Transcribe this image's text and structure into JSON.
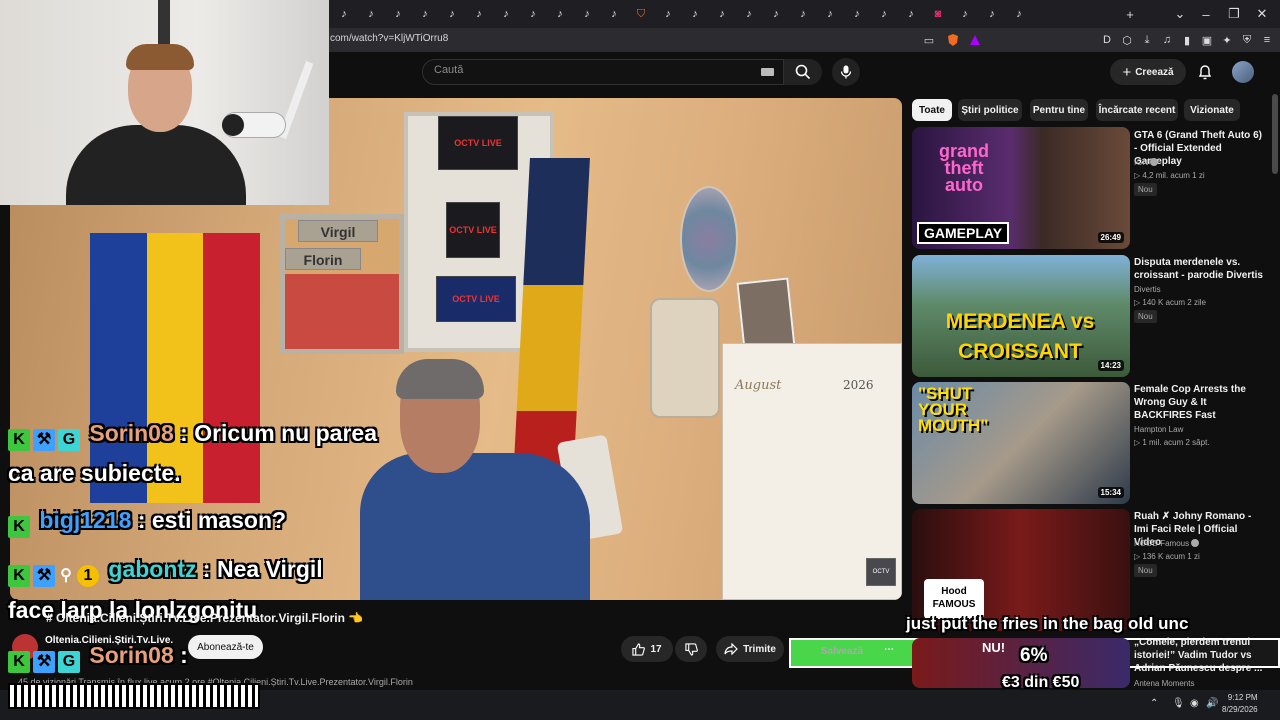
{
  "browser": {
    "url": "com/watch?v=KljWTiOrru8",
    "tab_icons": [
      "tiktok-icon",
      "tiktok-icon",
      "tiktok-icon",
      "tiktok-icon",
      "tiktok-icon",
      "tiktok-icon",
      "tiktok-icon",
      "tiktok-icon",
      "tiktok-icon",
      "tiktok-icon",
      "tiktok-icon",
      "brave-icon",
      "tiktok-icon",
      "tiktok-icon",
      "tiktok-icon",
      "tiktok-icon",
      "tiktok-icon",
      "tiktok-icon",
      "tiktok-icon",
      "tiktok-icon",
      "tiktok-icon",
      "tiktok-icon",
      "instagram-icon",
      "tiktok-icon",
      "tiktok-icon",
      "tiktok-icon"
    ]
  },
  "header": {
    "search_placeholder": "Caută",
    "create_label": "Creează"
  },
  "chat": [
    {
      "user": "Sorin08",
      "message": " : Oricum nu parea",
      "user_color": "#e8a07a"
    },
    {
      "continuation": "ca are subiecte."
    },
    {
      "user": "bigj1218",
      "message": " : esti mason?",
      "user_color": "#3ea0ff"
    },
    {
      "user": "gabontz",
      "message": " : Nea Virgil",
      "user_color": "#3fd4d4",
      "coin": "1"
    },
    {
      "continuation": "face larp la lonlzgonitu"
    },
    {
      "user": "Sorin08",
      "message": " :",
      "user_color": "#e8a07a"
    }
  ],
  "video": {
    "title": "# Oltenia.Cilieni.Știri.Tv.Live.Prezentator.Virgil.Florin 👈",
    "channel": "Oltenia.Cilieni.Știri.Tv.Live.",
    "subscribe_label": "Abonează-te",
    "likes": "17",
    "share_label": "Trimite",
    "save_label": "Salvează",
    "description": "45 de vizionări  Transmis în flux live acum 2 ore  #Oltenia.Cilieni.Știri.Tv.Live.Prezentator.Virgil.Florin",
    "wall_signs": [
      "Virgil",
      "Florin"
    ],
    "posters": [
      "OCTV LIVE",
      "OCTV LIVE",
      "OCTV LIVE"
    ],
    "calendar_month": "August",
    "calendar_year": "2026"
  },
  "chips": [
    "Toate",
    "Știri politice",
    "Pentru tine",
    "Încărcate recent",
    "Vizionate"
  ],
  "recommendations": [
    {
      "title": "GTA 6 (Grand Theft Auto 6) - Official Extended Gameplay",
      "channel": "IGN",
      "meta": "▷ 4,2 mil.  acum 1 zi",
      "badge": "Nou",
      "duration": "26:49",
      "thumb_text": "GAMEPLAY"
    },
    {
      "title": "Disputa merdenele vs. croissant - parodie Divertis",
      "channel": "Divertis",
      "meta": "▷ 140 K  acum 2 zile",
      "badge": "Nou",
      "duration": "14:23",
      "thumb_text": "MERDENEA vs CROISSANT"
    },
    {
      "title": "Female Cop Arrests the Wrong Guy & It BACKFIRES Fast",
      "channel": "Hampton Law",
      "meta": "▷ 1 mil.  acum 2 săpt.",
      "badge": "",
      "duration": "15:34",
      "thumb_text": "\"SHUT YOUR MOUTH\""
    },
    {
      "title": "Ruah ✗ Johny Romano - Imi Faci Rele | Official Video",
      "channel": "HOOD Famous",
      "meta": "▷ 136 K  acum 1 zi",
      "badge": "Nou",
      "duration": "",
      "thumb_text": "Hood FAMOUS"
    },
    {
      "title": "„Comele, pierdem trenul istoriei!” Vadim Tudor vs Adrian Păunescu despre ...",
      "channel": "Antena Moments",
      "meta": "",
      "badge": "",
      "duration": "",
      "thumb_text": "NU!"
    }
  ],
  "overlay": {
    "caption": "just put the fries in the bag old unc",
    "donation_percent": "6%",
    "donation_progress": 0.06,
    "donation_amount": "€3 din €50"
  },
  "taskbar": {
    "time": "9:12 PM",
    "date": "8/29/2026"
  },
  "colors": {
    "flag_blue": "#1e3f9a",
    "flag_yellow": "#f2c21b",
    "flag_red": "#c8202e",
    "accent_green": "#4ad64a"
  }
}
